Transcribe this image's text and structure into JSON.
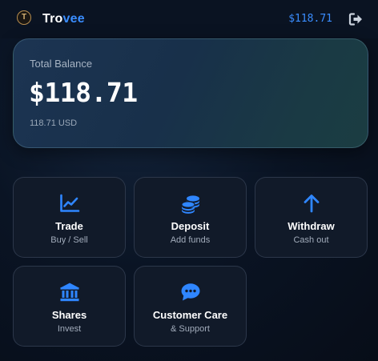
{
  "header": {
    "logo_letter": "T",
    "brand_part1": "Tro",
    "brand_part2": "vee",
    "balance": "$118.71",
    "logout_icon": "logout-icon"
  },
  "balance_card": {
    "label": "Total Balance",
    "amount": "$118.71",
    "sub": "118.71 USD"
  },
  "actions": [
    {
      "title": "Trade",
      "subtitle": "Buy / Sell",
      "icon": "chart-line-icon"
    },
    {
      "title": "Deposit",
      "subtitle": "Add funds",
      "icon": "coins-icon"
    },
    {
      "title": "Withdraw",
      "subtitle": "Cash out",
      "icon": "arrow-up-icon"
    },
    {
      "title": "Shares",
      "subtitle": "Invest",
      "icon": "bank-icon"
    },
    {
      "title": "Customer Care",
      "subtitle": "& Support",
      "icon": "chat-icon"
    }
  ],
  "colors": {
    "accent": "#3a8dff",
    "gold": "#b78d4e"
  }
}
